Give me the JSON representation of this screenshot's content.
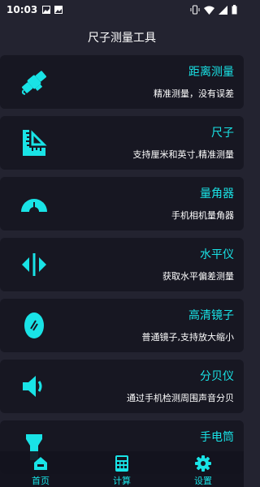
{
  "status": {
    "time": "10:03",
    "left_icons": [
      "photo-icon",
      "gallery-icon"
    ],
    "right_icons": [
      "vibrate-icon",
      "wifi-icon",
      "signal-icon",
      "battery-icon"
    ]
  },
  "page_title": "尺子测量工具",
  "accent": "#19e3e6",
  "tools": [
    {
      "name": "距离测量",
      "desc": "精准测量，没有误差",
      "icon": "satellite-icon"
    },
    {
      "name": "尺子",
      "desc": "支持厘米和英寸,精准测量",
      "icon": "ruler-icon"
    },
    {
      "name": "量角器",
      "desc": "手机相机量角器",
      "icon": "protractor-icon"
    },
    {
      "name": "水平仪",
      "desc": "获取水平偏差测量",
      "icon": "level-icon"
    },
    {
      "name": "高清镜子",
      "desc": "普通镜子,支持放大缩小",
      "icon": "mirror-icon"
    },
    {
      "name": "分贝仪",
      "desc": "通过手机检测周围声音分贝",
      "icon": "speaker-icon"
    },
    {
      "name": "手电筒",
      "desc": "",
      "icon": "flashlight-icon"
    }
  ],
  "tabs": [
    {
      "label": "首页",
      "icon": "home-icon"
    },
    {
      "label": "计算",
      "icon": "calculator-icon"
    },
    {
      "label": "设置",
      "icon": "gear-icon"
    }
  ]
}
